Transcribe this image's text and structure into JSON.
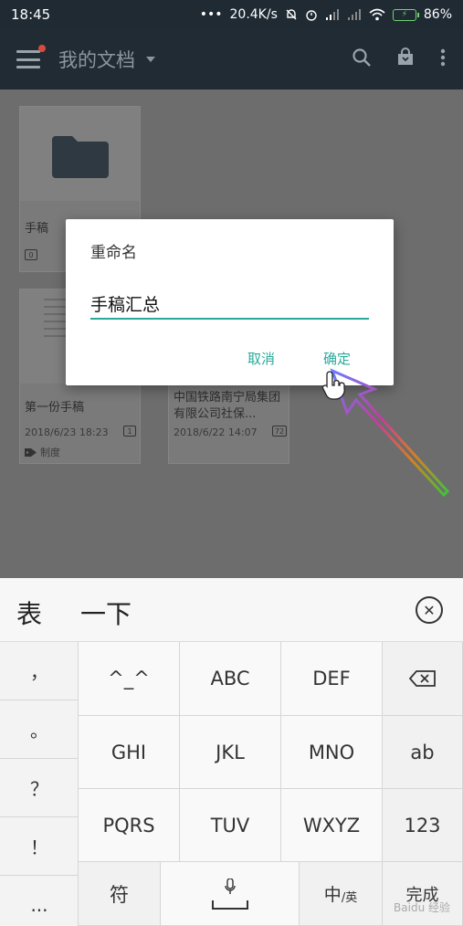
{
  "status_bar": {
    "time": "18:45",
    "speed": "20.4K/s",
    "dots": "•••",
    "battery": "86%"
  },
  "app_bar": {
    "title": "我的文档"
  },
  "cards": [
    {
      "name": "手稿",
      "badge": "0"
    },
    {
      "name": "第一份手稿",
      "date": "2018/6/23 18:23",
      "badge": "1",
      "tag": "制度"
    },
    {
      "name": "中国铁路南宁局集团有限公司社保...",
      "date": "2018/6/22 14:07",
      "badge": "72"
    }
  ],
  "dialog": {
    "title": "重命名",
    "input_value": "手稿汇总",
    "cancel_label": "取消",
    "confirm_label": "确定"
  },
  "keyboard": {
    "candidates": [
      "表",
      "一下"
    ],
    "punctuation": [
      "，",
      "。",
      "？",
      "！",
      "..."
    ],
    "rows": [
      [
        "^_^",
        "ABC",
        "DEF"
      ],
      [
        "GHI",
        "JKL",
        "MNO"
      ],
      [
        "PQRS",
        "TUV",
        "WXYZ"
      ]
    ],
    "right_column": [
      "ab",
      "123"
    ],
    "bottom": {
      "symbol_label": "符",
      "lang_main": "中",
      "lang_sub": "/英",
      "done_label": "完成"
    },
    "watermark": "Baidu 经验"
  },
  "colors": {
    "accent": "#2aa99a",
    "appbar": "#212b33",
    "notification_dot": "#d94a3f"
  }
}
